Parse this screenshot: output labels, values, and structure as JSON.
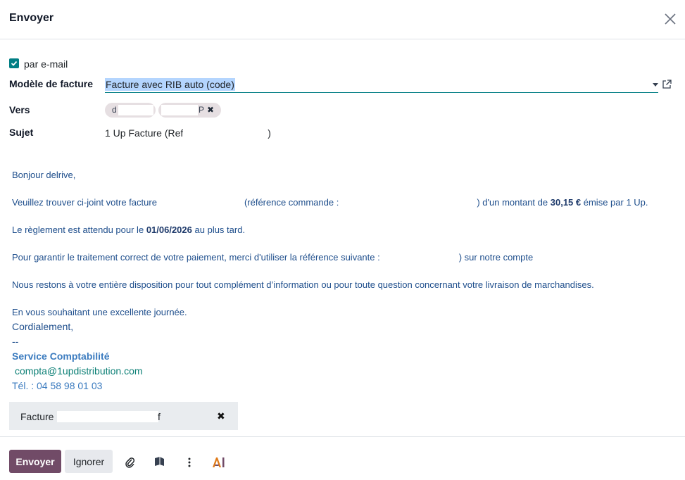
{
  "dialog": {
    "title": "Envoyer"
  },
  "form": {
    "email_checkbox_label": "par e-mail",
    "template_label": "Modèle de facture",
    "template_value": "Facture avec RIB auto (code)",
    "to_label": "Vers",
    "recipients": [
      {
        "label": "d"
      },
      {
        "label": "P"
      }
    ],
    "subject_label": "Sujet",
    "subject_prefix": "1 Up Facture (Ref",
    "subject_suffix": ")"
  },
  "body": {
    "greeting": "Bonjour delrive,",
    "line1_a": "Veuillez trouver ci-joint votre facture",
    "line1_b": "(référence commande :",
    "line1_c": ") d'un montant de",
    "line1_amount": "30,15 €",
    "line1_d": "émise par 1 Up.",
    "line2_a": "Le règlement est attendu pour le",
    "line2_date": "01/06/2026",
    "line2_b": "au plus tard.",
    "line3_a": "Pour garantir le traitement correct de votre paiement, merci d'utiliser la référence suivante :",
    "line3_b": ") sur notre compte",
    "line4": "Nous restons à votre entière disposition pour tout complément d’information ou pour toute question concernant votre livraison de marchandises.",
    "line5": "En vous souhaitant une excellente journée.",
    "closing": "Cordialement,",
    "separator": "--",
    "signature_name": "Service Comptabilité",
    "signature_email": "compta@1updistribution.com",
    "signature_phone": "Tél. : 04 58 98 01 03"
  },
  "attachment": {
    "prefix": "Facture",
    "suffix": "f"
  },
  "footer": {
    "send_label": "Envoyer",
    "ignore_label": "Ignorer"
  },
  "colors": {
    "primary": "#714b67",
    "accent": "#017e84",
    "link": "#3b7bbf"
  }
}
